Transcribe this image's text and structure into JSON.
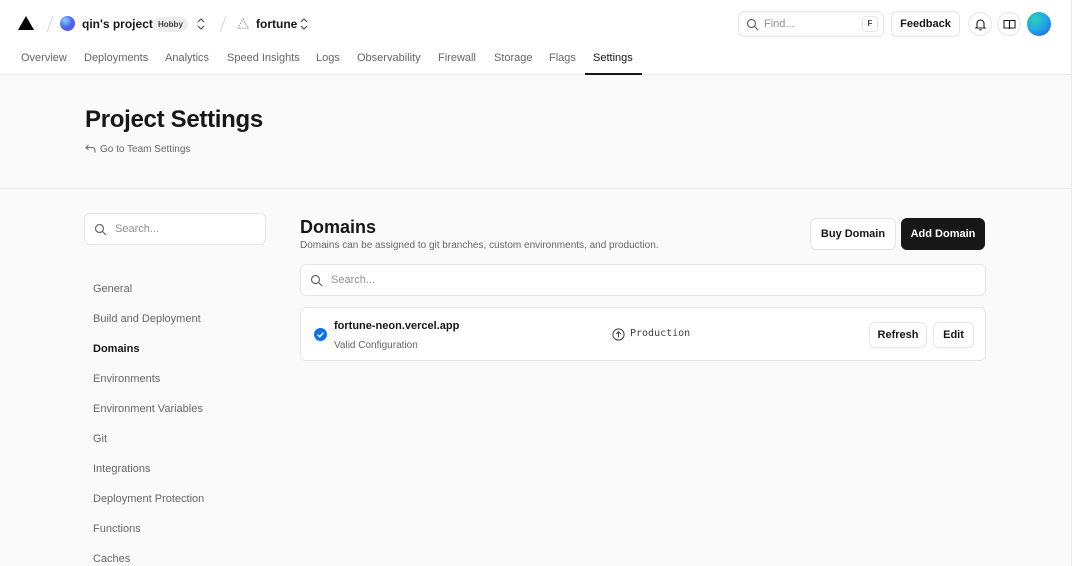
{
  "topbar": {
    "team_name": "qin's projects",
    "team_plan": "Hobby",
    "project_name": "fortune",
    "find_placeholder": "Find...",
    "find_shortcut": "F",
    "feedback_label": "Feedback",
    "icons": [
      "vercel-logo-icon",
      "chevron-updown-icon",
      "project-triangle-icon",
      "search-icon",
      "bell-icon",
      "book-icon"
    ]
  },
  "tabs": [
    {
      "label": "Overview"
    },
    {
      "label": "Deployments"
    },
    {
      "label": "Analytics"
    },
    {
      "label": "Speed Insights"
    },
    {
      "label": "Logs"
    },
    {
      "label": "Observability"
    },
    {
      "label": "Firewall"
    },
    {
      "label": "Storage"
    },
    {
      "label": "Flags"
    },
    {
      "label": "Settings",
      "active": true
    }
  ],
  "header": {
    "title": "Project Settings",
    "back_link": "Go to Team Settings"
  },
  "sidebar": {
    "search_placeholder": "Search...",
    "items": [
      {
        "label": "General"
      },
      {
        "label": "Build and Deployment"
      },
      {
        "label": "Domains",
        "active": true
      },
      {
        "label": "Environments"
      },
      {
        "label": "Environment Variables"
      },
      {
        "label": "Git"
      },
      {
        "label": "Integrations"
      },
      {
        "label": "Deployment Protection"
      },
      {
        "label": "Functions"
      },
      {
        "label": "Caches"
      }
    ]
  },
  "domains": {
    "title": "Domains",
    "subtitle": "Domains can be assigned to git branches, custom environments, and production.",
    "buy_label": "Buy Domain",
    "add_label": "Add Domain",
    "search_placeholder": "Search...",
    "list": [
      {
        "name": "fortune-neon.vercel.app",
        "status": "Valid Configuration",
        "environment": "Production",
        "refresh_label": "Refresh",
        "edit_label": "Edit"
      }
    ]
  },
  "colors": {
    "accent_dark": "#171717",
    "check_blue": "#0a72ef",
    "background_muted": "#fafafa",
    "border": "#e5e5e5"
  }
}
